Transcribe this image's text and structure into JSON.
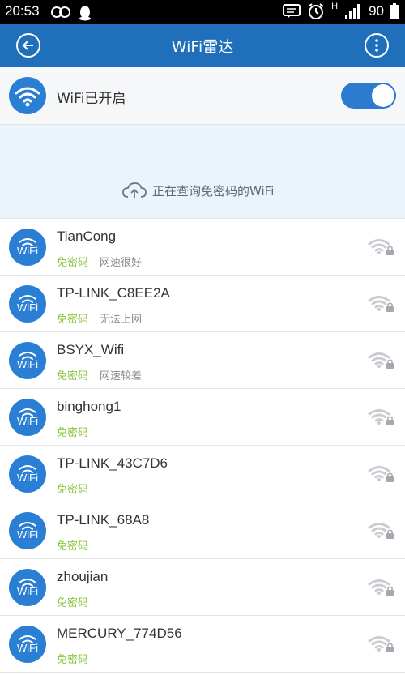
{
  "status_bar": {
    "time": "20:53",
    "battery": "90",
    "network": "H"
  },
  "app_bar": {
    "title": "WiFi雷达",
    "back_icon": "back-arrow-icon",
    "more_icon": "more-vertical-icon"
  },
  "wifi_toggle": {
    "label": "WiFi已开启",
    "enabled": true
  },
  "search_panel": {
    "message": "正在查询免密码的WiFi"
  },
  "networks": [
    {
      "name": "TianCong",
      "free_label": "免密码",
      "status": "网速很好",
      "icon_text": "WiFi"
    },
    {
      "name": "TP-LINK_C8EE2A",
      "free_label": "免密码",
      "status": "无法上网",
      "icon_text": "WiFi"
    },
    {
      "name": "BSYX_Wifi",
      "free_label": "免密码",
      "status": "网速较差",
      "icon_text": "WiFi"
    },
    {
      "name": "binghong1",
      "free_label": "免密码",
      "status": "",
      "icon_text": "WiFi"
    },
    {
      "name": "TP-LINK_43C7D6",
      "free_label": "免密码",
      "status": "",
      "icon_text": "WiFi"
    },
    {
      "name": "TP-LINK_68A8",
      "free_label": "免密码",
      "status": "",
      "icon_text": "WiFi"
    },
    {
      "name": "zhoujian",
      "free_label": "免密码",
      "status": "",
      "icon_text": "WiFi"
    },
    {
      "name": "MERCURY_774D56",
      "free_label": "免密码",
      "status": "",
      "icon_text": "WiFi"
    }
  ],
  "colors": {
    "app_bar": "#1f6fba",
    "accent": "#2a7fd4",
    "free_green": "#8cc63f"
  }
}
